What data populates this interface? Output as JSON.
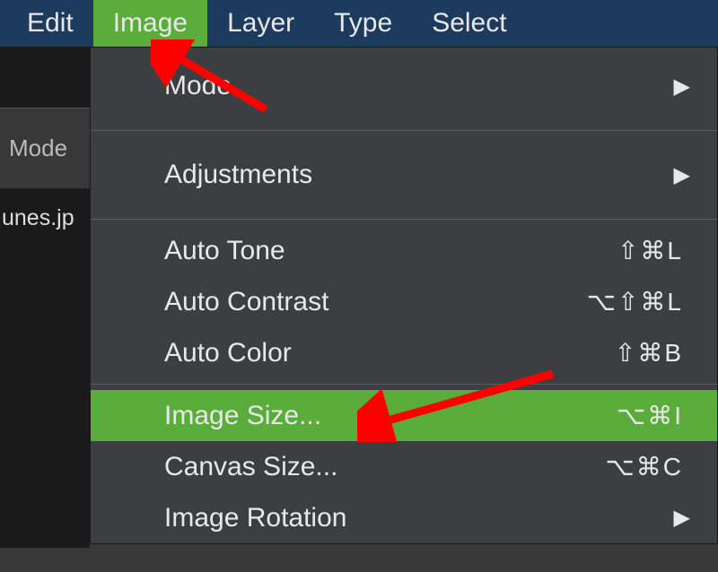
{
  "menubar": {
    "items": [
      {
        "label": "Edit"
      },
      {
        "label": "Image",
        "active": true
      },
      {
        "label": "Layer"
      },
      {
        "label": "Type"
      },
      {
        "label": "Select"
      }
    ]
  },
  "sidepanel": {
    "label": "Mode"
  },
  "tab": {
    "label": "unes.jp"
  },
  "dropdown": {
    "items": [
      {
        "label": "Mode",
        "submenu": true
      },
      {
        "label": "Adjustments",
        "submenu": true
      },
      {
        "label": "Auto Tone",
        "shortcut": "⇧⌘L"
      },
      {
        "label": "Auto Contrast",
        "shortcut": "⌥⇧⌘L"
      },
      {
        "label": "Auto Color",
        "shortcut": "⇧⌘B"
      },
      {
        "label": "Image Size...",
        "shortcut": "⌥⌘I",
        "highlighted": true
      },
      {
        "label": "Canvas Size...",
        "shortcut": "⌥⌘C"
      },
      {
        "label": "Image Rotation",
        "submenu": true
      }
    ]
  },
  "annotation": {
    "color": "#ff0000"
  }
}
